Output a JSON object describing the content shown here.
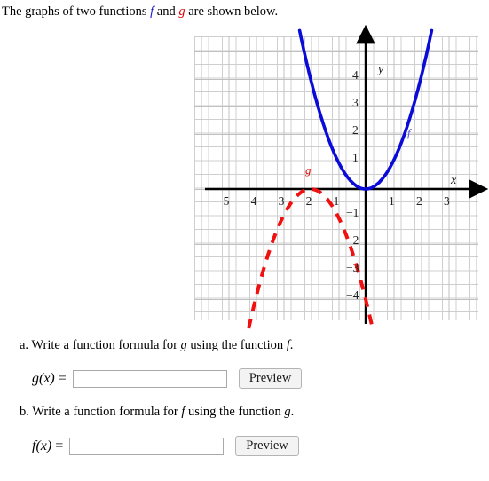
{
  "prompt": {
    "part1": "The graphs of two functions ",
    "f": "f",
    "part2": " and ",
    "g": "g",
    "part3": " are shown below."
  },
  "graph": {
    "axis_x_name": "x",
    "axis_y_name": "y",
    "label_f": "f",
    "label_g": "g",
    "x_ticks": [
      "−5",
      "−4",
      "−3",
      "−2",
      "−1",
      "1",
      "2",
      "3"
    ],
    "y_ticks": [
      "4",
      "3",
      "2",
      "1",
      "−1",
      "−2",
      "−3",
      "−4"
    ],
    "color_f": "#0b0bd8",
    "color_g": "#f01010",
    "color_axis": "#000000",
    "color_grid": "#cfcfcf"
  },
  "chart_data": {
    "type": "line",
    "title": "",
    "xlabel": "x",
    "ylabel": "y",
    "xlim": [
      -6.3,
      4.0
    ],
    "ylim": [
      -5.5,
      5.0
    ],
    "grid": true,
    "legend": "inline-curve-labels",
    "x_ticks": [
      -5,
      -4,
      -3,
      -2,
      -1,
      1,
      2,
      3
    ],
    "y_ticks": [
      4,
      3,
      2,
      1,
      -1,
      -2,
      -3,
      -4
    ],
    "series": [
      {
        "name": "f",
        "style": "solid",
        "color": "#0b0bd8",
        "formula": "f(x) = x^2",
        "vertex": [
          0,
          0
        ],
        "x": [
          -2.3,
          -2.0,
          -1.5,
          -1.0,
          -0.5,
          0,
          0.5,
          1.0,
          1.5,
          2.0,
          2.3
        ],
        "values": [
          5.29,
          4.0,
          2.25,
          1.0,
          0.25,
          0,
          0.25,
          1.0,
          2.25,
          4.0,
          5.29
        ]
      },
      {
        "name": "g",
        "style": "dashed",
        "color": "#f01010",
        "formula": "g(x) = -(x + 2)^2",
        "vertex": [
          -2,
          0
        ],
        "x": [
          -4.3,
          -4.0,
          -3.5,
          -3.0,
          -2.5,
          -2.0,
          -1.5,
          -1.0,
          -0.5,
          0,
          0.3
        ],
        "values": [
          -5.29,
          -4.0,
          -2.25,
          -1.0,
          -0.25,
          0,
          -0.25,
          -1.0,
          -2.25,
          -4.0,
          -5.29
        ]
      }
    ]
  },
  "questions": [
    {
      "marker": "a.",
      "text_before": " Write a function formula for ",
      "var1": "g",
      "text_mid": " using the function ",
      "var2": "f",
      "text_after": ".",
      "field_label_fn": "g",
      "field_label_arg": "(x)",
      "field_label_eq": " =",
      "input_value": "",
      "input_placeholder": "",
      "button_label": "Preview"
    },
    {
      "marker": "b.",
      "text_before": " Write a function formula for ",
      "var1": "f",
      "text_mid": " using the function ",
      "var2": "g",
      "text_after": ".",
      "field_label_fn": "f",
      "field_label_arg": "(x)",
      "field_label_eq": " =",
      "input_value": "",
      "input_placeholder": "",
      "button_label": "Preview"
    }
  ]
}
